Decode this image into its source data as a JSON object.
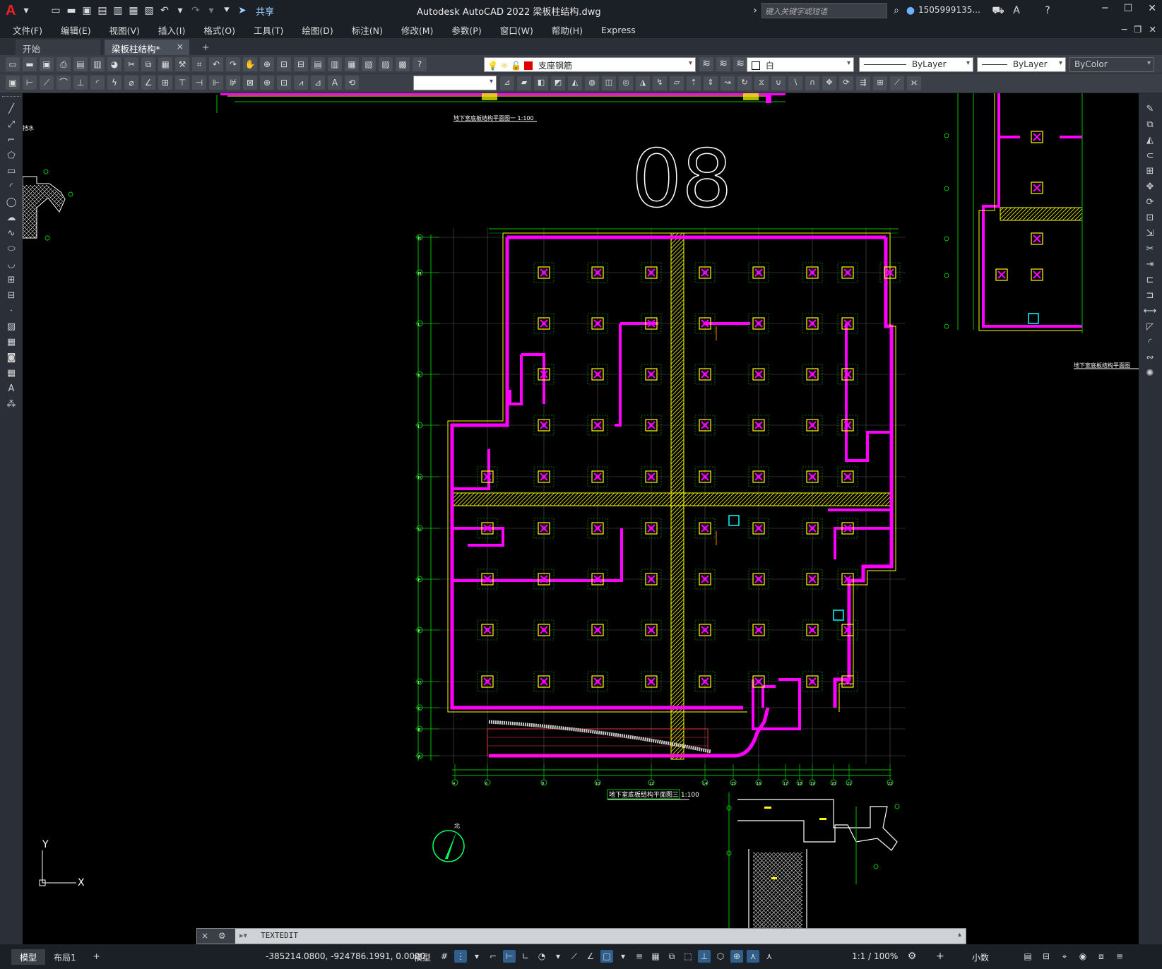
{
  "app": {
    "title": "Autodesk AutoCAD 2022    梁板柱结构.dwg",
    "share_label": "共享",
    "search_placeholder": "键入关键字或短语",
    "user": "1505999135...",
    "logo": "A"
  },
  "menu": [
    "文件(F)",
    "编辑(E)",
    "视图(V)",
    "插入(I)",
    "格式(O)",
    "工具(T)",
    "绘图(D)",
    "标注(N)",
    "修改(M)",
    "参数(P)",
    "窗口(W)",
    "帮助(H)",
    "Express"
  ],
  "file_tabs": {
    "start": "开始",
    "active": "梁板柱结构*",
    "close": "×",
    "add": "+"
  },
  "properties": {
    "layer": "支座钢筋",
    "layer_color": "#e00000",
    "color": "白",
    "linetype": "ByLayer",
    "lineweight": "ByLayer",
    "plotstyle": "ByColor"
  },
  "drawing": {
    "view_number": "08",
    "title_top": "地下室底板结构平面图一  1:100",
    "title_main": "地下室底板结构平面图三  1:100",
    "title_right": "地下室底板结构平面图",
    "fragment_left": "挡水",
    "grid_bottom": [
      "4",
      "6",
      "8",
      "10",
      "12",
      "14",
      "15",
      "16",
      "17",
      "18",
      "19",
      "20",
      "21",
      "22"
    ],
    "grid_left": [
      "N",
      "M",
      "L",
      "K",
      "J",
      "H",
      "G",
      "F",
      "E",
      "D",
      "C",
      "B",
      "A"
    ],
    "axis_y": "Y",
    "axis_x": "X"
  },
  "command": {
    "text": "TEXTEDIT",
    "left_close": "×"
  },
  "status": {
    "tab_model": "模型",
    "tab_layout": "布局1",
    "tab_add": "+",
    "coords": "-385214.0800, -924786.1991, 0.0000",
    "mode": "模型",
    "scale": "1:1 / 100%",
    "units": "小数"
  },
  "colors": {
    "magenta": "#ff00ff",
    "yellow": "#ffff00",
    "green": "#00c000",
    "white": "#ffffff",
    "cyan": "#00ffff",
    "orange": "#ff8000"
  }
}
